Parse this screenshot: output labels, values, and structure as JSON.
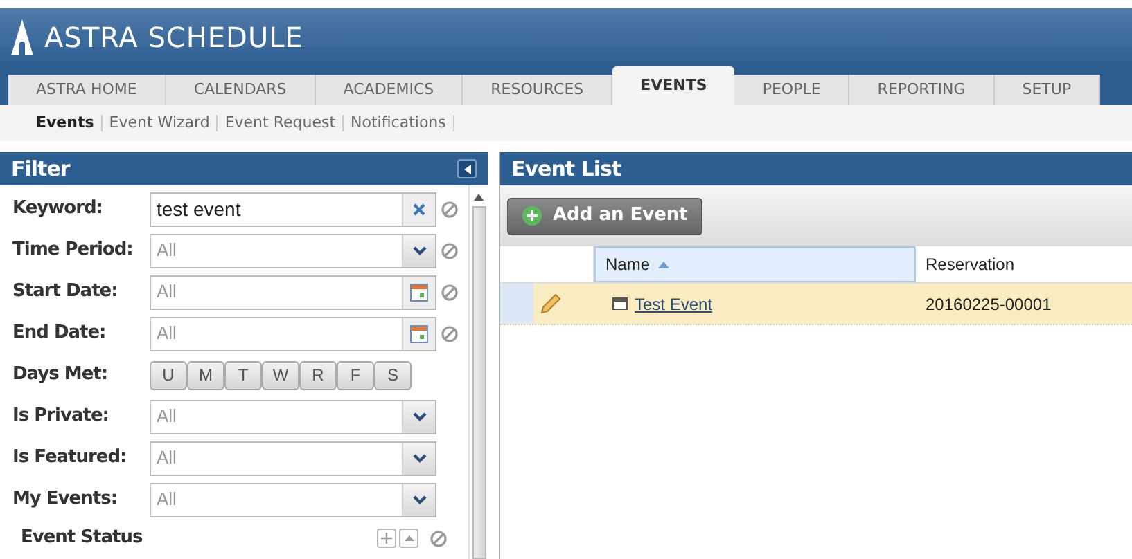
{
  "app": {
    "title": "ASTRA SCHEDULE"
  },
  "tabs": [
    {
      "label": "ASTRA HOME",
      "selected": false
    },
    {
      "label": "CALENDARS",
      "selected": false
    },
    {
      "label": "ACADEMICS",
      "selected": false
    },
    {
      "label": "RESOURCES",
      "selected": false
    },
    {
      "label": "EVENTS",
      "selected": true
    },
    {
      "label": "PEOPLE",
      "selected": false
    },
    {
      "label": "REPORTING",
      "selected": false
    },
    {
      "label": "SETUP",
      "selected": false
    }
  ],
  "subnav": [
    {
      "label": "Events",
      "selected": true
    },
    {
      "label": "Event Wizard",
      "selected": false
    },
    {
      "label": "Event Request",
      "selected": false
    },
    {
      "label": "Notifications",
      "selected": false
    }
  ],
  "filter": {
    "title": "Filter",
    "fields": [
      {
        "kind": "text",
        "label": "Keyword:",
        "value": "test event"
      },
      {
        "kind": "select",
        "label": "Time Period:",
        "value": "All",
        "clearable": true
      },
      {
        "kind": "date",
        "label": "Start Date:",
        "value": "All"
      },
      {
        "kind": "date",
        "label": "End Date:",
        "value": "All"
      },
      {
        "kind": "days",
        "label": "Days Met:",
        "days": [
          "U",
          "M",
          "T",
          "W",
          "R",
          "F",
          "S"
        ]
      },
      {
        "kind": "select",
        "label": "Is Private:",
        "value": "All",
        "clearable": false
      },
      {
        "kind": "select",
        "label": "Is Featured:",
        "value": "All",
        "clearable": false
      },
      {
        "kind": "select",
        "label": "My Events:",
        "value": "All",
        "clearable": false
      }
    ],
    "section": "Event Status"
  },
  "event_list": {
    "title": "Event List",
    "add_button": "Add an Event",
    "columns": [
      {
        "label": "Name",
        "sorted": true
      },
      {
        "label": "Reservation",
        "sorted": false
      }
    ],
    "rows": [
      {
        "name": "Test Event",
        "reservation": "20160225-00001",
        "selected": true
      }
    ]
  }
}
